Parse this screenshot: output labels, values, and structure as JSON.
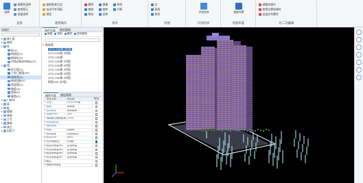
{
  "ribbon": {
    "groups": [
      {
        "title": "选择",
        "buttons": [
          {
            "label": "按属性选择"
          },
          {
            "label": "查找图元"
          },
          {
            "label": "批量选择"
          }
        ]
      },
      {
        "title": "通用操作",
        "buttons": [
          {
            "label": "复制到其它层"
          },
          {
            "label": "自动平齐顶板"
          },
          {
            "label": "锁定"
          }
        ]
      },
      {
        "title": "修改",
        "buttons": [
          {
            "label": "删除"
          },
          {
            "label": "复制"
          },
          {
            "label": "移动"
          },
          {
            "label": "镜像"
          },
          {
            "label": "旋转"
          },
          {
            "label": "延伸"
          },
          {
            "label": "修剪"
          },
          {
            "label": "打断"
          }
        ]
      },
      {
        "title": "绘图",
        "buttons": [
          {
            "label": "点"
          },
          {
            "label": "直线"
          },
          {
            "label": "矩形"
          }
        ]
      },
      {
        "title": "识别柱体",
        "buttons": [
          {
            "label": "识别柱体"
          }
        ]
      },
      {
        "title": "智能布置",
        "buttons": [
          {
            "label": "智能布置"
          }
        ]
      },
      {
        "title": "柱二次编辑",
        "buttons": [
          {
            "label": "调整柱端头"
          },
          {
            "label": "按墙位置绘制柱"
          },
          {
            "label": "自适应布置柱"
          }
        ]
      }
    ]
  },
  "left_panel": {
    "title": "导航栏",
    "items": [
      {
        "label": "施工段",
        "level": 0
      },
      {
        "label": "轴线",
        "level": 0
      },
      {
        "label": "柱",
        "level": 0
      },
      {
        "label": "柱(Z)",
        "level": 1
      },
      {
        "label": "构造柱(Z)",
        "level": 1
      },
      {
        "label": "砌体柱(Z)",
        "level": 1
      },
      {
        "label": "约束边缘非阴影区(Z)",
        "level": 1
      },
      {
        "label": "墙",
        "level": 0
      },
      {
        "label": "剪力墙(Q)",
        "level": 1
      },
      {
        "label": "人防门框墙(RF)",
        "level": 1
      },
      {
        "label": "砌体墙(Q)",
        "level": 1,
        "selected": true
      },
      {
        "label": "砌体加筋(Y)",
        "level": 1
      },
      {
        "label": "保温墙(Q)",
        "level": 1
      },
      {
        "label": "暗梁(A)",
        "level": 1
      },
      {
        "label": "墙垛(E)",
        "level": 1
      },
      {
        "label": "幕墙(Q)",
        "level": 1
      },
      {
        "label": "门窗洞",
        "level": 0
      },
      {
        "label": "梁",
        "level": 0
      },
      {
        "label": "板",
        "level": 0
      },
      {
        "label": "楼梯",
        "level": 0
      },
      {
        "label": "装修",
        "level": 0
      },
      {
        "label": "土方",
        "level": 0
      },
      {
        "label": "基础",
        "level": 0
      },
      {
        "label": "其它",
        "level": 0
      },
      {
        "label": "自定义",
        "level": 0
      }
    ]
  },
  "component_panel": {
    "tabs": [
      "构件列表",
      "图纸管理"
    ],
    "toolbar": [
      "新建",
      "复制",
      "删除",
      "层间复制"
    ],
    "tree_root": "砌体墙",
    "items": [
      "QTQ-200厚 (外墙)",
      "QTQ-200厚 (内墙)",
      "QTQ-100厚",
      "QTQ-100厚 (内墙)",
      "QTQ-200厚 (内墙)",
      "QTQ-100厚 (内墙)",
      "QTQ-200厚 (内墙)",
      "QTQ-100厚 (内墙)",
      "砌墙100 (外墙)"
    ],
    "selected_index": 0
  },
  "properties": {
    "tabs": [
      "属性列表",
      "图层管理"
    ],
    "headers": [
      "属性名称",
      "属性值",
      "附加"
    ],
    "rows": [
      {
        "n": "1",
        "k": "名称",
        "v": "QTQ-200厚",
        "c": false,
        "blue": true
      },
      {
        "n": "2",
        "k": "类别",
        "v": "砌体墙",
        "c": false,
        "blue": false
      },
      {
        "n": "3",
        "k": "结构类别",
        "v": "砌块砌体",
        "c": false,
        "blue": true
      },
      {
        "n": "4",
        "k": "厚度(mm)",
        "v": "200",
        "c": false,
        "blue": true
      },
      {
        "n": "5",
        "k": "轴线距左墙皮距离(mm)",
        "v": "(100)",
        "c": false,
        "blue": false
      },
      {
        "n": "6",
        "k": "砌体通长筋",
        "v": "",
        "c": false,
        "blue": true
      },
      {
        "n": "7",
        "k": "横向短筋",
        "v": "",
        "c": false,
        "blue": true
      },
      {
        "n": "8",
        "k": "材质",
        "v": "标准砖",
        "c": false,
        "blue": false
      },
      {
        "n": "9",
        "k": "砂浆类型",
        "v": "(混合砂浆)",
        "c": false,
        "blue": false
      },
      {
        "n": "10",
        "k": "砂浆标号",
        "v": "(M5)",
        "c": false,
        "blue": true
      },
      {
        "n": "11",
        "k": "内/外墙标志",
        "v": "(外墙)",
        "c": true,
        "blue": false
      },
      {
        "n": "12",
        "k": "起点顶标高(m)",
        "v": "层顶标高",
        "c": false,
        "blue": false
      },
      {
        "n": "13",
        "k": "终点顶标高(m)",
        "v": "层顶标高",
        "c": false,
        "blue": false
      },
      {
        "n": "14",
        "k": "起点底标高(m)",
        "v": "层底标高",
        "c": false,
        "blue": false
      },
      {
        "n": "15",
        "k": "终点底标高(m)",
        "v": "层底标高",
        "c": false,
        "blue": false
      },
      {
        "n": "16",
        "k": "备注",
        "v": "",
        "c": false,
        "blue": false
      },
      {
        "n": "17",
        "k": "钢筋业务属性",
        "v": "",
        "c": false,
        "blue": false
      }
    ]
  },
  "colors": {
    "viewport_bg": "#000000",
    "accent": "#2f6fc0",
    "facade_purple": "#6b5bb0",
    "facade_orange": "#d9822b",
    "pile_cyan": "#a9e6f0",
    "slab_white": "#dfe7ee"
  },
  "viewport": {
    "model": "tower-3d"
  },
  "icons": [
    "select-icon",
    "copy-icon",
    "move-icon",
    "rotate-icon",
    "line-icon",
    "view-cube-icon"
  ]
}
